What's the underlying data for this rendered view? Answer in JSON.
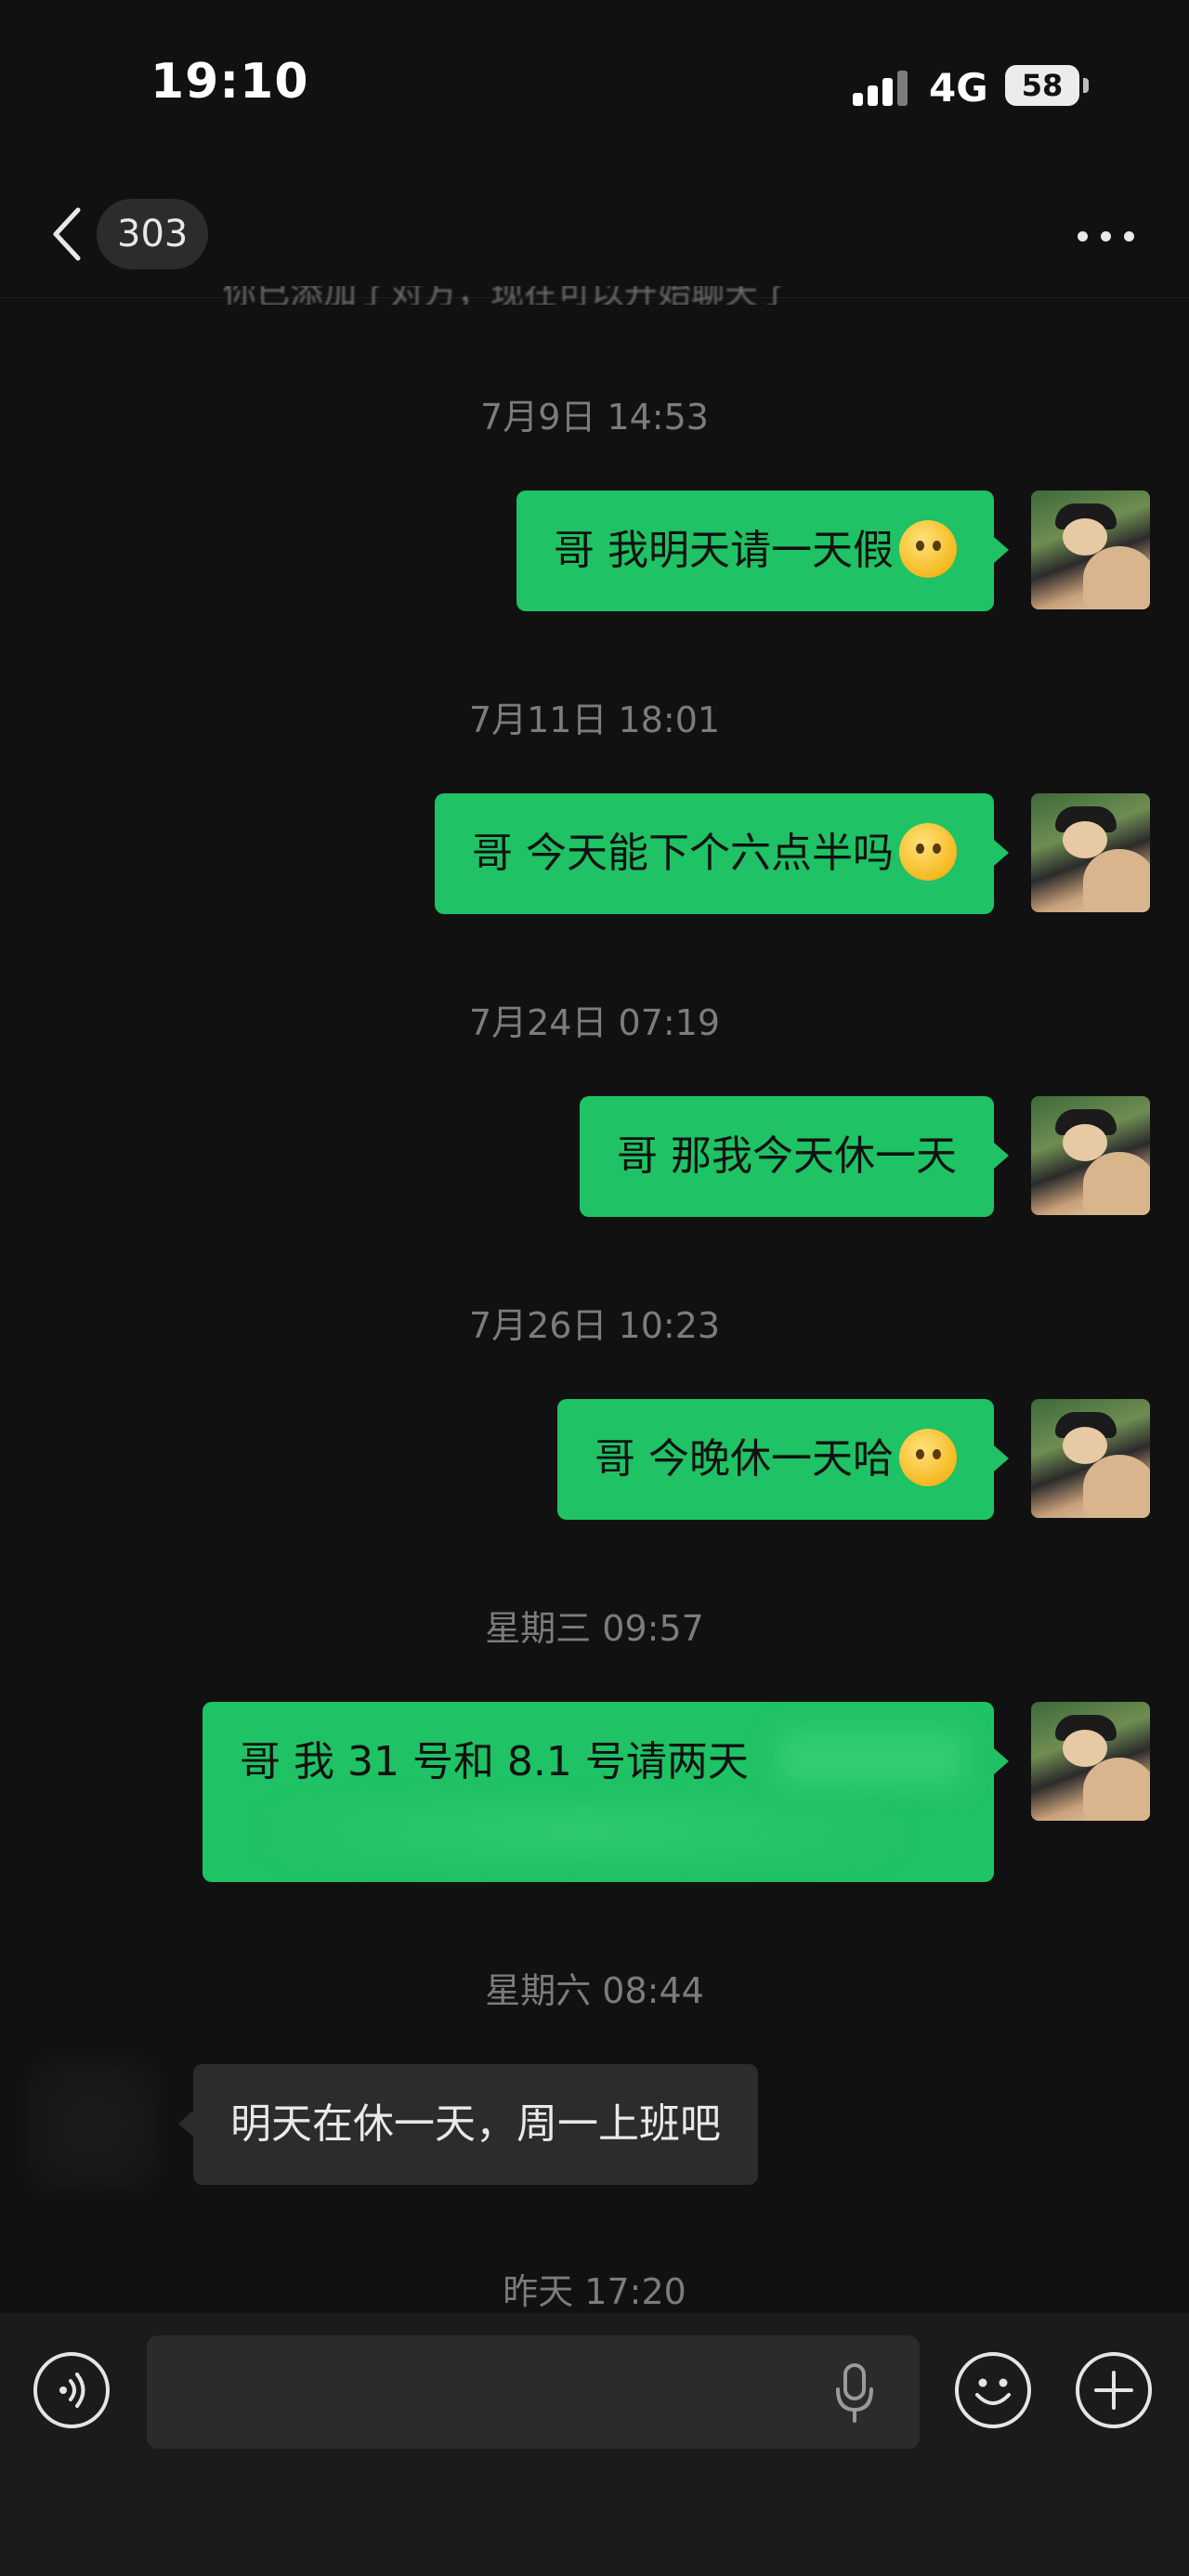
{
  "status_bar": {
    "time": "19:10",
    "network": "4G",
    "battery": "58"
  },
  "nav": {
    "unread_count": "303",
    "back_icon": "chevron-left-icon",
    "more_icon": "more-dots-icon"
  },
  "clipped_message": "你已添加了对方，现在可以开始聊天了",
  "messages": [
    {
      "timestamp": "7月9日 14:53",
      "text": "哥 我明天请一天假",
      "direction": "out",
      "emoji": "saluting-face"
    },
    {
      "timestamp": "7月11日 18:01",
      "text": "哥 今天能下个六点半吗",
      "direction": "out",
      "emoji": "pleading-face"
    },
    {
      "timestamp": "7月24日 07:19",
      "text": "哥 那我今天休一天",
      "direction": "out"
    },
    {
      "timestamp": "7月26日 10:23",
      "text": "哥 今晚休一天哈",
      "direction": "out",
      "emoji": "saluting-face"
    },
    {
      "timestamp": "星期三 09:57",
      "text": "哥 我 31 号和 8.1 号请两天",
      "direction": "out"
    },
    {
      "timestamp": "星期六 08:44",
      "text": "明天在休一天，周一上班吧",
      "direction": "in"
    },
    {
      "timestamp": "昨天 17:20"
    }
  ],
  "input_bar": {
    "voice_icon": "voice-toggle-icon",
    "mic_icon": "microphone-icon",
    "emoji_icon": "emoji-icon",
    "plus_icon": "plus-icon",
    "input_value": ""
  },
  "colors": {
    "background": "#111111",
    "outgoing_bubble": "#1fc264",
    "incoming_bubble": "#2c2c2c",
    "timestamp": "#7c7c7c"
  }
}
